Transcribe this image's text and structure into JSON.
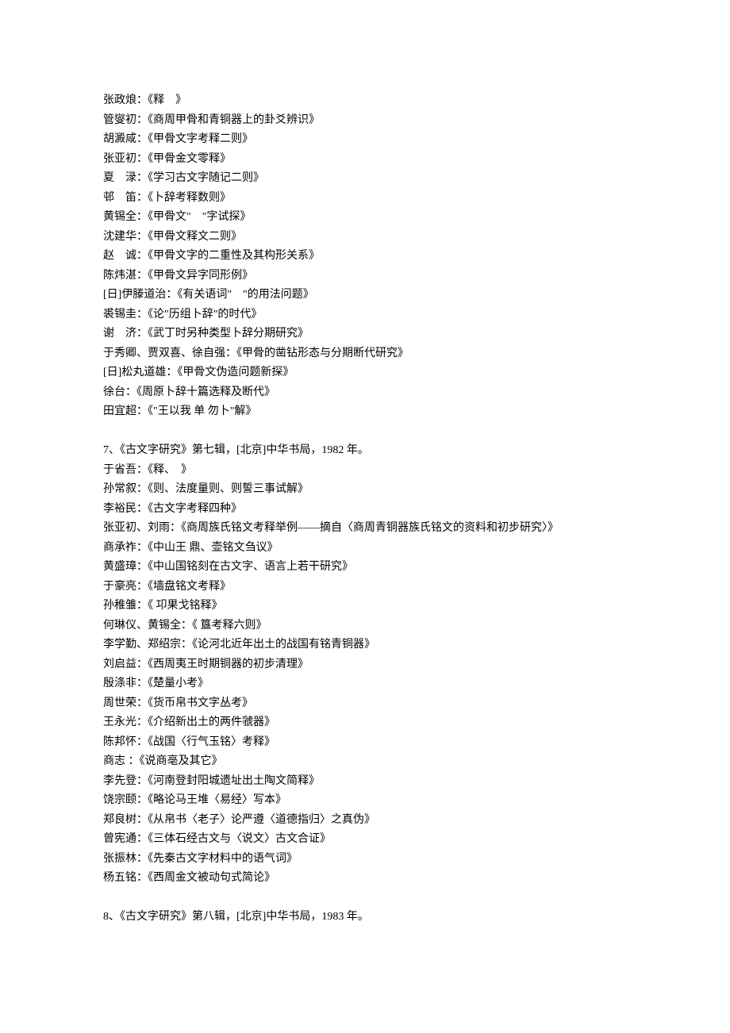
{
  "section6_entries": [
    "张政烺：《释　》",
    "管燮初：《商周甲骨和青铜器上的卦爻辨识》",
    "胡澱咸：《甲骨文字考释二则》",
    "张亚初：《甲骨金文零释》",
    "夏　渌：《学习古文字随记二则》",
    "邨　笛：《卜辞考释数则》",
    "黄锡全：《甲骨文\"　\"字试探》",
    "沈建华：《甲骨文释文二则》",
    "赵　诚：《甲骨文字的二重性及其构形关系》",
    "陈炜湛：《甲骨文异字同形例》",
    "[日]伊滕道治：《有关语词\"　\"的用法问题》",
    "裘锡圭：《论\"历组卜辞\"的时代》",
    "谢　济：《武丁时另种类型卜辞分期研究》",
    "于秀卿、贾双喜、徐自强：《甲骨的凿钻形态与分期断代研究》",
    "[日]松丸道雄：《甲骨文伪造问题新探》",
    "徐台：《周原卜辞十篇选释及断代》",
    "田宜超：《\"王以我 单 勿卜\"解》"
  ],
  "section7_heading": "7、《古文字研究》第七辑，[北京]中华书局，1982 年。",
  "section7_entries": [
    "于省吾：《释𢎘、　》",
    "孙常叙：《则、法度量则、则誓三事试解》",
    "李裕民：《古文字考释四种》",
    "张亚初、刘雨：《商周族氏铭文考释举例——摘自〈商周青铜器族氏铭文的资料和初步研究〉》",
    "商承祚：《中山王 鼎、壶铭文刍议》",
    "黄盛璋：《中山国铭刻在古文字、语言上若干研究》",
    "于豪亮：《墙盘铭文考释》",
    "孙稚雏：《 卭果戈铭释》",
    "何琳仪、黄锡全：《 簋考释六则》",
    "李学勤、郑绍宗：《论河北近年出土的战国有铭青铜器》",
    "刘启益：《西周夷王时期铜器的初步清理》",
    "殷涤非：《楚量小考》",
    "周世荣：《货币帛书文字丛考》",
    "王永光：《介绍新出土的两件虢器》",
    "陈邦怀：《战国〈行气玉铭〉考释》",
    "商志 ：《说商亳及其它》",
    "李先登：《河南登封阳城遗址出土陶文简释》",
    "饶宗颐：《略论马王堆〈易经〉写本》",
    "郑良树：《从帛书〈老子〉论严遵〈道德指归〉之真伪》",
    "曾宪通：《三体石经古文与〈说文〉古文合证》",
    "张振林：《先秦古文字材料中的语气词》",
    "杨五铭：《西周金文被动句式简论》"
  ],
  "section8_heading": "8、《古文字研究》第八辑，[北京]中华书局，1983 年。"
}
